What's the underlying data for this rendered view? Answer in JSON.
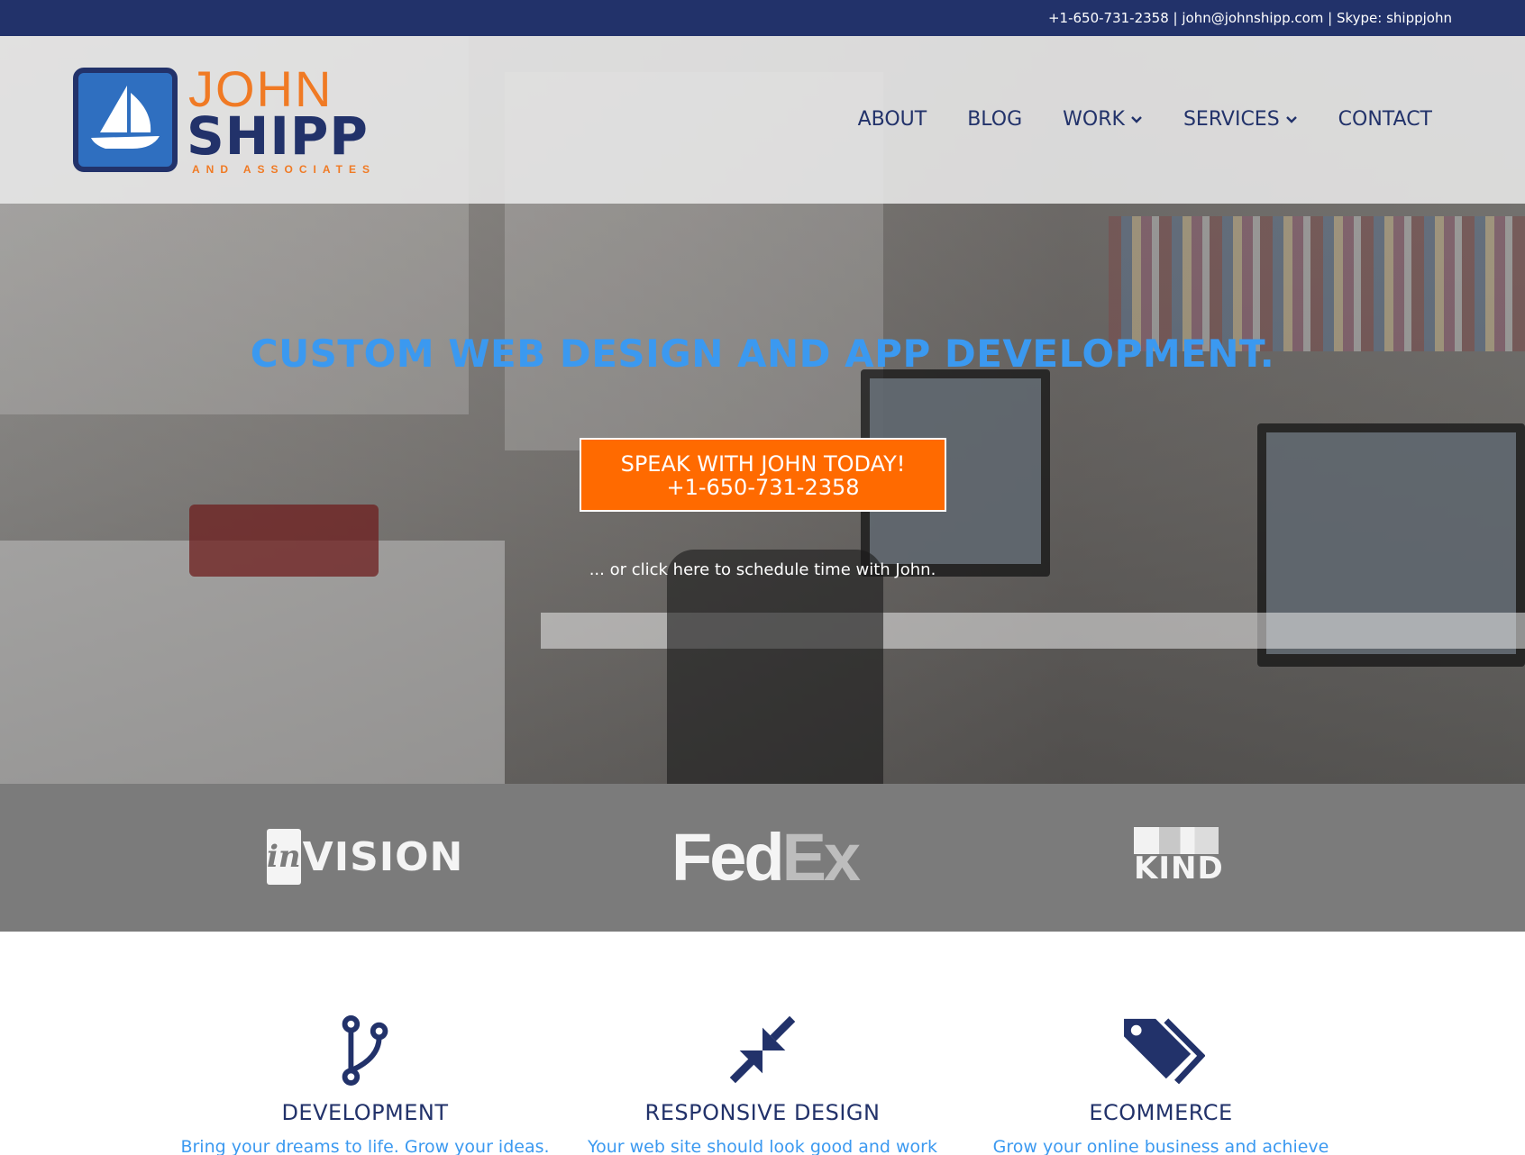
{
  "topbar": {
    "contact": "+1-650-731-2358 | john@johnshipp.com | Skype: shippjohn"
  },
  "logo": {
    "line1": "JOHN",
    "line2": "SHIPP",
    "line3": "AND ASSOCIATES"
  },
  "nav": {
    "items": [
      {
        "label": "ABOUT",
        "dropdown": false
      },
      {
        "label": "BLOG",
        "dropdown": false
      },
      {
        "label": "WORK",
        "dropdown": true
      },
      {
        "label": "SERVICES",
        "dropdown": true
      },
      {
        "label": "CONTACT",
        "dropdown": false
      }
    ]
  },
  "hero": {
    "headline": "CUSTOM WEB DESIGN AND APP DEVELOPMENT.",
    "cta_line1": "SPEAK WITH JOHN TODAY!",
    "cta_line2": "+1-650-731-2358",
    "schedule": "... or click here to schedule time with John."
  },
  "clients": {
    "invision_in": "in",
    "invision_rest": "VISION",
    "fedex_fed": "Fed",
    "fedex_ex": "Ex",
    "kind": "KIND"
  },
  "services": [
    {
      "title": "DEVELOPMENT",
      "desc": "Bring your dreams to life. Grow your ideas.",
      "icon": "code-branch-icon"
    },
    {
      "title": "RESPONSIVE DESIGN",
      "desc": "Your web site should look good and work",
      "icon": "compress-arrows-icon"
    },
    {
      "title": "ECOMMERCE",
      "desc": "Grow your online business and achieve",
      "icon": "tags-icon"
    }
  ],
  "colors": {
    "navy": "#22326a",
    "accent_blue": "#3b99f0",
    "orange": "#ff6a00",
    "client_band": "#7b7b7b"
  }
}
